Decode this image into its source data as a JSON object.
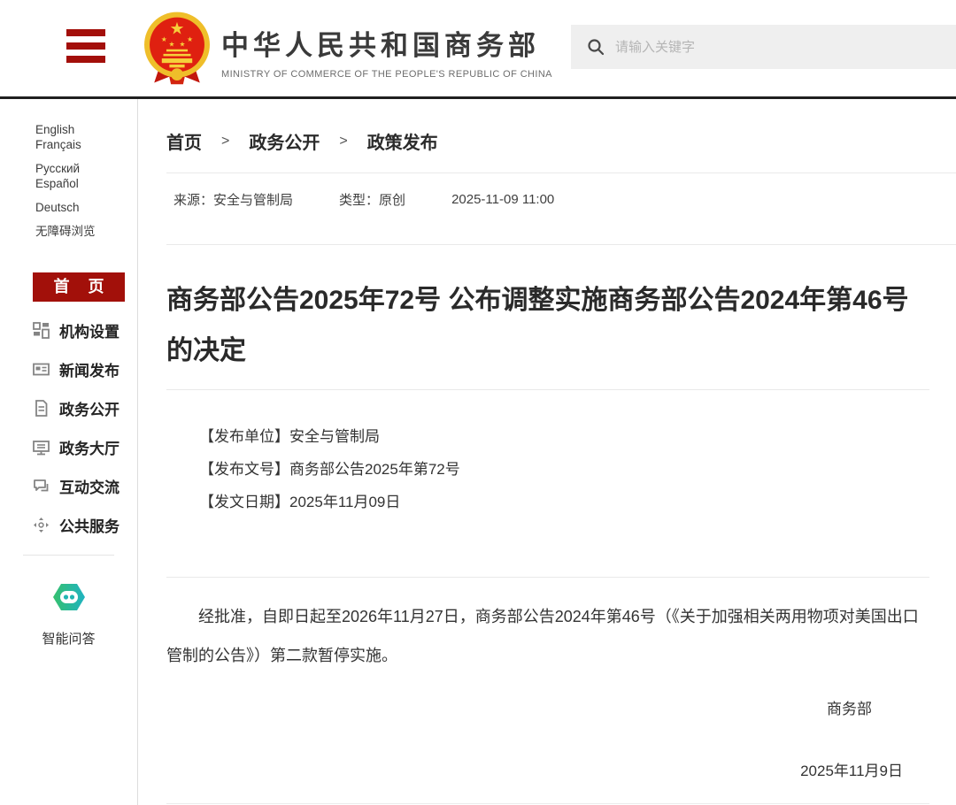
{
  "header": {
    "title": "中华人民共和国商务部",
    "subtitle": "MINISTRY OF COMMERCE OF THE PEOPLE'S REPUBLIC OF CHINA",
    "search": {
      "placeholder": "请输入关键字"
    }
  },
  "sidebar": {
    "languages": [
      "English",
      "Français",
      "Русский",
      "Español",
      "Deutsch"
    ],
    "accessibility": "无障碍浏览",
    "home": "首 页",
    "menu": [
      {
        "label": "机构设置",
        "icon": "org-grid-icon"
      },
      {
        "label": "新闻发布",
        "icon": "news-icon"
      },
      {
        "label": "政务公开",
        "icon": "document-icon"
      },
      {
        "label": "政务大厅",
        "icon": "service-hall-icon"
      },
      {
        "label": "互动交流",
        "icon": "chat-icon"
      },
      {
        "label": "公共服务",
        "icon": "public-service-icon"
      }
    ],
    "smart_qa": "智能问答"
  },
  "breadcrumb": {
    "items": [
      "首页",
      "政务公开",
      "政策发布"
    ],
    "separator": ">"
  },
  "meta": {
    "source_label": "来源：",
    "source": "安全与管制局",
    "type_label": "类型：",
    "type": "原创",
    "datetime": "2025-11-09 11:00"
  },
  "article": {
    "title": "商务部公告2025年72号 公布调整实施商务部公告2024年第46号的决定",
    "info_lines": [
      "【发布单位】安全与管制局",
      "【发布文号】商务部公告2025年第72号",
      "【发文日期】2025年11月09日"
    ],
    "body": "经批准，自即日起至2026年11月27日，商务部公告2024年第46号（《关于加强相关两用物项对美国出口管制的公告》）第二款暂停实施。",
    "signer": "商务部",
    "sign_date": "2025年11月9日"
  },
  "colors": {
    "brand_red": "#A30F0A",
    "header_bar": "#202020",
    "search_bg": "#EFEFEF",
    "qa_green": "#35C06E",
    "qa_teal": "#1FB3C1",
    "icon_gray": "#848484"
  }
}
